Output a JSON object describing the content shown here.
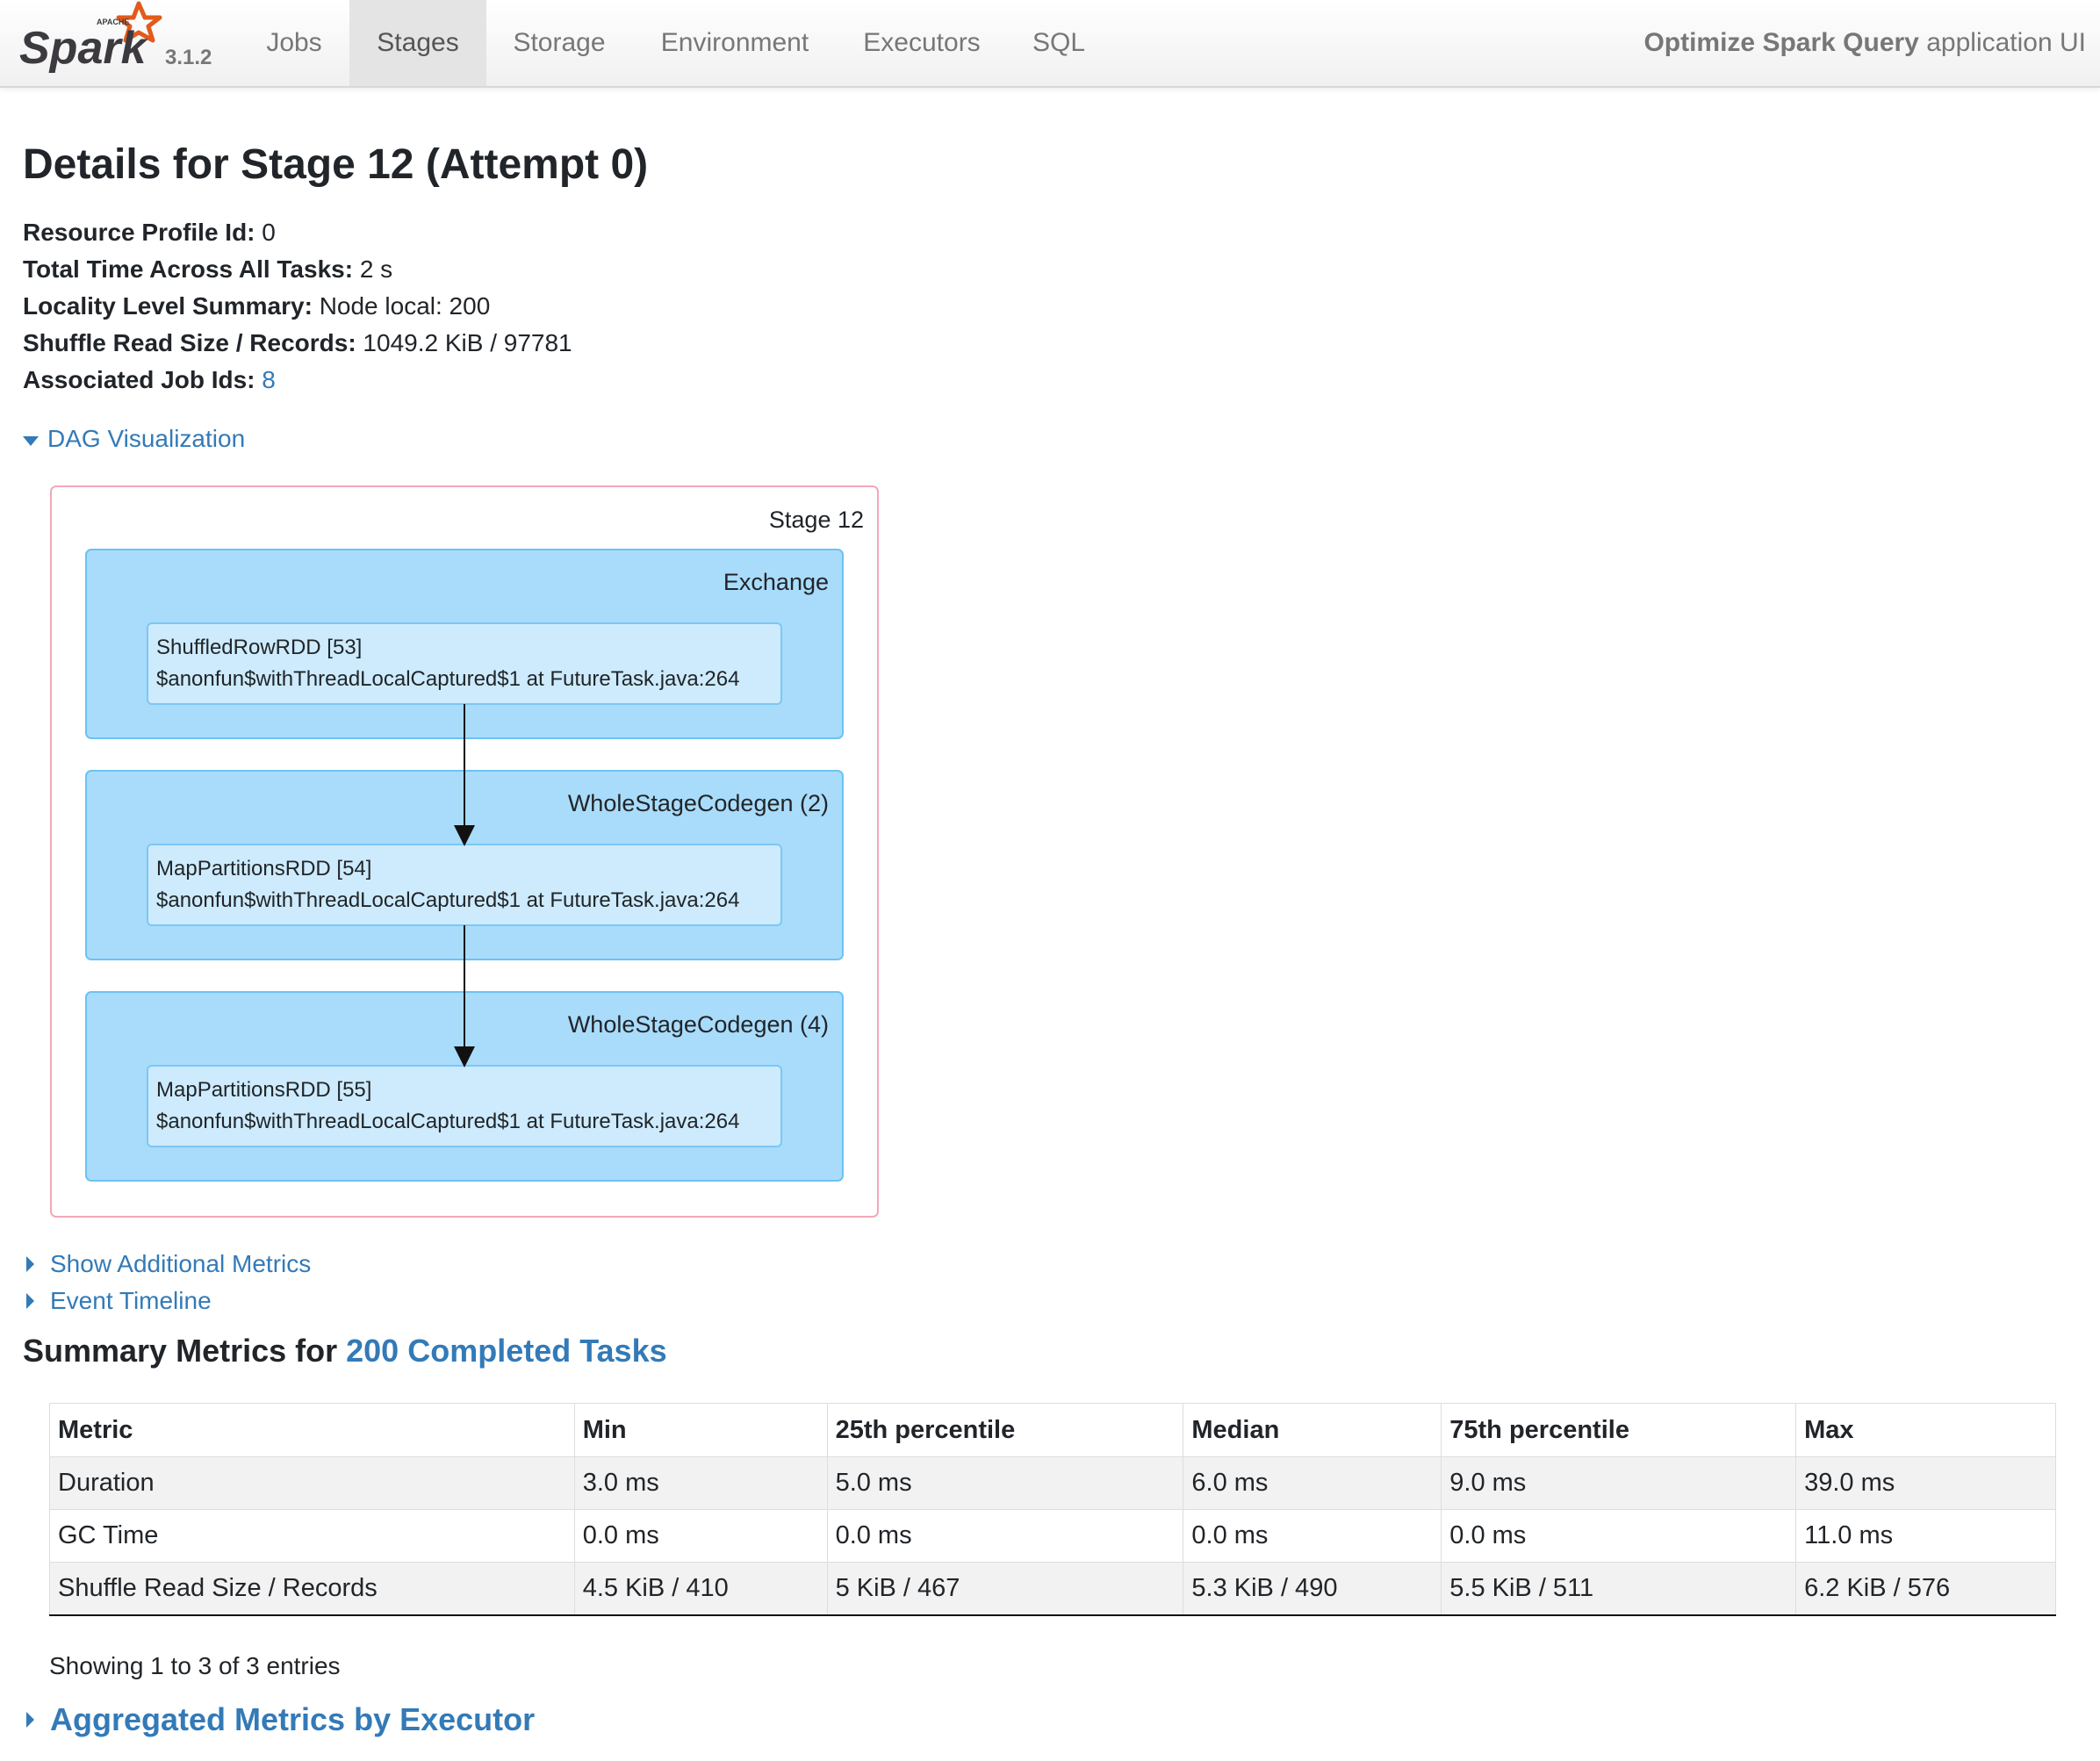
{
  "brand": {
    "logo_text": "Spark",
    "logo_small_text": "APACHE",
    "version": "3.1.2"
  },
  "nav": {
    "tabs": [
      {
        "label": "Jobs",
        "active": false
      },
      {
        "label": "Stages",
        "active": true
      },
      {
        "label": "Storage",
        "active": false
      },
      {
        "label": "Environment",
        "active": false
      },
      {
        "label": "Executors",
        "active": false
      },
      {
        "label": "SQL",
        "active": false
      }
    ],
    "app_name": "Optimize Spark Query",
    "app_suffix": "application UI"
  },
  "page": {
    "title": "Details for Stage 12 (Attempt 0)"
  },
  "info": {
    "resource_profile": {
      "label": "Resource Profile Id:",
      "value": "0"
    },
    "total_time": {
      "label": "Total Time Across All Tasks:",
      "value": "2 s"
    },
    "locality": {
      "label": "Locality Level Summary:",
      "value": "Node local: 200"
    },
    "shuffle_read": {
      "label": "Shuffle Read Size / Records:",
      "value": "1049.2 KiB / 97781"
    },
    "job_ids": {
      "label": "Associated Job Ids:",
      "value": "8"
    }
  },
  "dag": {
    "toggle_label": "DAG Visualization",
    "stage_label": "Stage 12",
    "clusters": [
      {
        "label": "Exchange",
        "rdd_name": "ShuffledRowRDD [53]",
        "rdd_callsite": "$anonfun$withThreadLocalCaptured$1 at FutureTask.java:264"
      },
      {
        "label": "WholeStageCodegen (2)",
        "rdd_name": "MapPartitionsRDD [54]",
        "rdd_callsite": "$anonfun$withThreadLocalCaptured$1 at FutureTask.java:264"
      },
      {
        "label": "WholeStageCodegen (4)",
        "rdd_name": "MapPartitionsRDD [55]",
        "rdd_callsite": "$anonfun$withThreadLocalCaptured$1 at FutureTask.java:264"
      }
    ],
    "colors": {
      "stage_border": "#f4a7b9",
      "cluster_fill": "#a9dcfb",
      "cluster_border": "#6cc2f5",
      "node_fill": "#cdebfd",
      "node_border": "#7cc7f3"
    }
  },
  "toggles": {
    "additional_metrics": "Show Additional Metrics",
    "event_timeline": "Event Timeline"
  },
  "summary": {
    "title_prefix": "Summary Metrics for",
    "title_link": "200 Completed Tasks",
    "headers": [
      "Metric",
      "Min",
      "25th percentile",
      "Median",
      "75th percentile",
      "Max"
    ],
    "rows": [
      [
        "Duration",
        "3.0 ms",
        "5.0 ms",
        "6.0 ms",
        "9.0 ms",
        "39.0 ms"
      ],
      [
        "GC Time",
        "0.0 ms",
        "0.0 ms",
        "0.0 ms",
        "0.0 ms",
        "11.0 ms"
      ],
      [
        "Shuffle Read Size / Records",
        "4.5 KiB / 410",
        "5 KiB / 467",
        "5.3 KiB / 490",
        "5.5 KiB / 511",
        "6.2 KiB / 576"
      ]
    ],
    "entries_text": "Showing 1 to 3 of 3 entries"
  },
  "aggregated": {
    "label": "Aggregated Metrics by Executor"
  },
  "colors": {
    "link": "#337ab7",
    "logo_orange": "#e25a1c",
    "logo_gray": "#3c3a3e"
  }
}
